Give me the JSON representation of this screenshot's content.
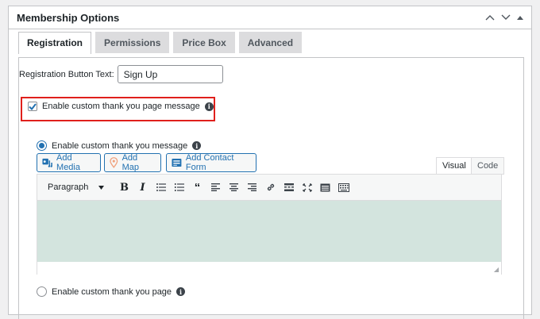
{
  "panel": {
    "title": "Membership Options",
    "controls": [
      "chevron-up-icon",
      "chevron-down-icon",
      "toggle-arrow-icon"
    ]
  },
  "tabs": [
    {
      "label": "Registration",
      "active": true
    },
    {
      "label": "Permissions",
      "active": false
    },
    {
      "label": "Price Box",
      "active": false
    },
    {
      "label": "Advanced",
      "active": false
    }
  ],
  "registration": {
    "button_text_label": "Registration Button Text:",
    "button_text_value": "Sign Up",
    "enable_message_checkbox_label": "Enable custom thank you page message",
    "enable_message_checked": true,
    "radio_message_label": "Enable custom thank you message",
    "radio_message_selected": true,
    "radio_page_label": "Enable custom thank you page",
    "radio_page_selected": false
  },
  "media_buttons": {
    "add_media": "Add Media",
    "add_map": "Add Map",
    "add_contact_form": "Add Contact Form"
  },
  "editor": {
    "tab_visual": "Visual",
    "tab_code": "Code",
    "active_tab": "Visual",
    "format_select": "Paragraph",
    "toolbar_icons": [
      "bold-icon",
      "italic-icon",
      "bullet-list-icon",
      "numbered-list-icon",
      "blockquote-icon",
      "align-left-icon",
      "align-center-icon",
      "align-right-icon",
      "link-icon",
      "read-more-icon",
      "fullscreen-icon",
      "toolbar-toggle-icon",
      "keyboard-icon"
    ],
    "content_bg": "#d3e4de"
  },
  "colors": {
    "accent": "#2271b1",
    "highlight_border": "#e0201c"
  }
}
